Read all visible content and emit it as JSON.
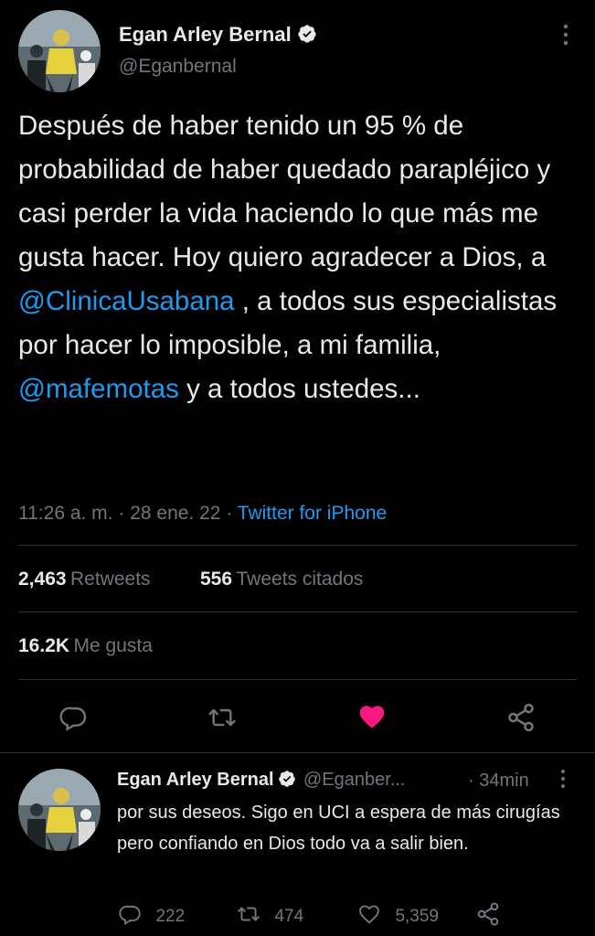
{
  "tweet": {
    "author_name": "Egan Arley Bernal",
    "author_handle": "@Eganbernal",
    "text_part1": "Después de haber tenido un 95 % de probabilidad de haber quedado parapléjico y casi perder la vida haciendo lo que más me gusta hacer. Hoy quiero agradecer a Dios, a ",
    "mention1": "@ClinicaUsabana",
    "text_part2": " , a todos sus especialistas por hacer lo imposible, a mi familia, ",
    "mention2": "@mafemotas",
    "text_part3": " y a todos ustedes...",
    "time": "11:26 a. m.",
    "date": "28 ene. 22",
    "separator": "·",
    "source": "Twitter for iPhone",
    "retweets_count": "2,463",
    "retweets_label": "Retweets",
    "quotes_count": "556",
    "quotes_label": "Tweets citados",
    "likes_count": "16.2K",
    "likes_label": "Me gusta"
  },
  "reply": {
    "author_name": "Egan Arley Bernal",
    "author_handle": "@Eganber...",
    "time": "· 34min",
    "text": "por sus deseos. Sigo en UCI a espera de más cirugías pero confiando en Dios todo va a salir bien.",
    "replies": "222",
    "retweets": "474",
    "likes": "5,359"
  },
  "colors": {
    "background": "#000000",
    "text": "#e7e9ea",
    "secondary": "#71767b",
    "accent": "#1d9bf0",
    "like": "#f91880",
    "divider": "#2f3336"
  },
  "icons": [
    "verified-icon",
    "more-icon",
    "reply-icon",
    "retweet-icon",
    "like-icon-filled",
    "share-icon",
    "like-icon"
  ]
}
